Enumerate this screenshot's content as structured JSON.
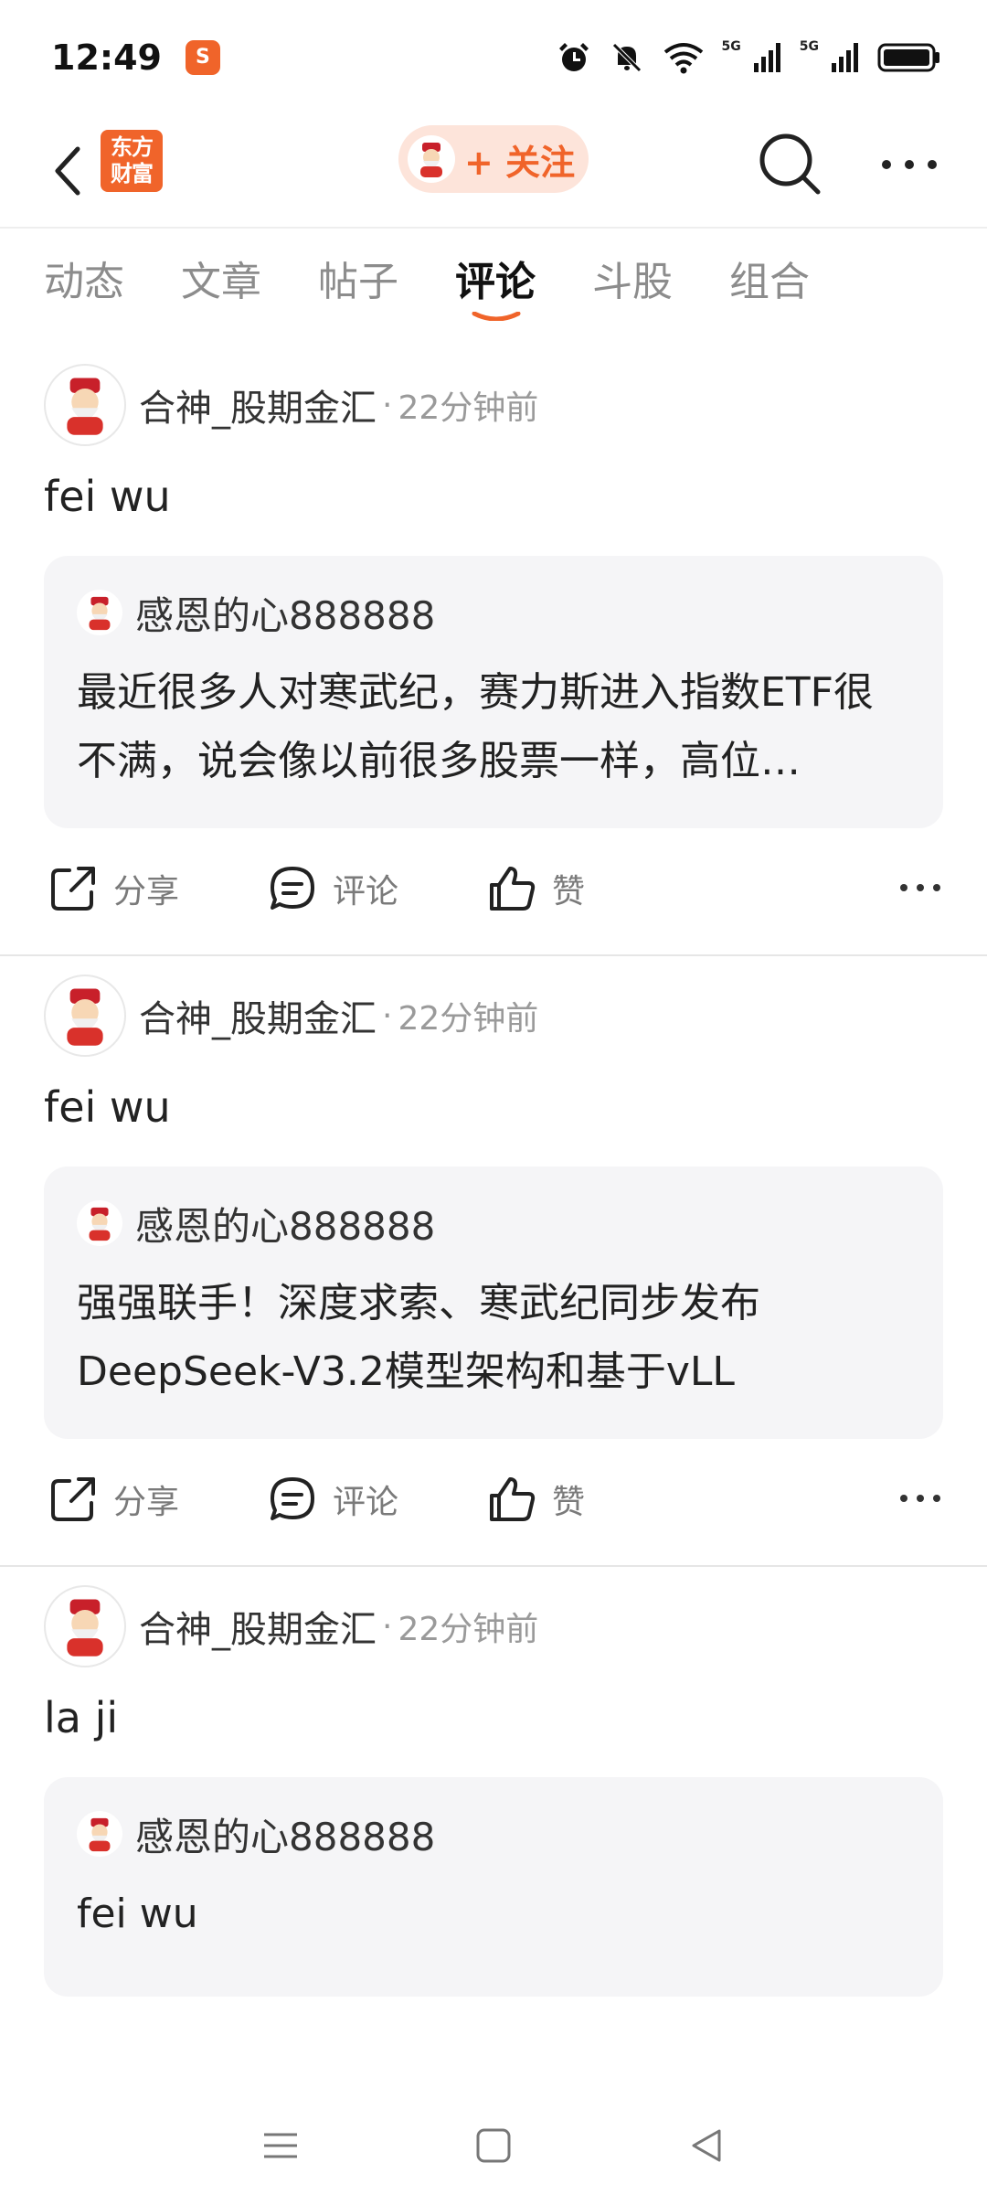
{
  "status_bar": {
    "time": "12:49",
    "app_icon": "S",
    "network": [
      "5G",
      "5G"
    ]
  },
  "header": {
    "logo_line1": "东方",
    "logo_line2": "财富",
    "follow_label": "+ 关注"
  },
  "tabs": [
    {
      "label": "动态",
      "active": false
    },
    {
      "label": "文章",
      "active": false
    },
    {
      "label": "帖子",
      "active": false
    },
    {
      "label": "评论",
      "active": true
    },
    {
      "label": "斗股",
      "active": false
    },
    {
      "label": "组合",
      "active": false
    }
  ],
  "posts": [
    {
      "author": "合神_股期金汇",
      "separator": "·",
      "time": "22分钟前",
      "body": "fei wu",
      "quote": {
        "author": "感恩的心888888",
        "text": "最近很多人对寒武纪，赛力斯进入指数ETF很不满，说会像以前很多股票一样，高位…"
      },
      "actions": {
        "share": "分享",
        "comment": "评论",
        "like": "赞"
      }
    },
    {
      "author": "合神_股期金汇",
      "separator": "·",
      "time": "22分钟前",
      "body": "fei wu",
      "quote": {
        "author": "感恩的心888888",
        "text": "强强联手！深度求索、寒武纪同步发布DeepSeek-V3.2模型架构和基于vLL"
      },
      "actions": {
        "share": "分享",
        "comment": "评论",
        "like": "赞"
      }
    },
    {
      "author": "合神_股期金汇",
      "separator": "·",
      "time": "22分钟前",
      "body": "la ji",
      "quote": {
        "author": "感恩的心888888",
        "text": "fei wu"
      }
    }
  ],
  "colors": {
    "accent": "#f0642a",
    "follow_bg": "#fde4da",
    "quote_bg": "#f5f5f7"
  }
}
